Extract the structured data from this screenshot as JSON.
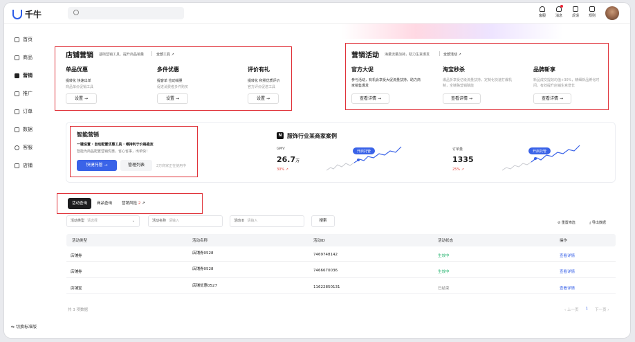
{
  "app": {
    "name": "千牛"
  },
  "top_actions": [
    {
      "label": "客服",
      "icon": "headset-icon"
    },
    {
      "label": "消息",
      "icon": "bell-icon"
    },
    {
      "label": "反馈",
      "icon": "edit-icon"
    },
    {
      "label": "规则",
      "icon": "book-icon"
    }
  ],
  "sidebar": {
    "items": [
      {
        "label": "首页",
        "icon": "home-icon"
      },
      {
        "label": "商品",
        "icon": "box-icon"
      },
      {
        "label": "营销",
        "icon": "marketing-icon",
        "active": true
      },
      {
        "label": "推广",
        "icon": "send-icon"
      },
      {
        "label": "订单",
        "icon": "order-icon"
      },
      {
        "label": "数据",
        "icon": "chart-icon"
      },
      {
        "label": "客服",
        "icon": "service-icon"
      },
      {
        "label": "店铺",
        "icon": "shop-icon"
      }
    ],
    "switch_label": "切换标准版"
  },
  "store_marketing": {
    "title": "店铺营销",
    "subtitle": "基础营销工具、提升商品销量",
    "link": "全部工具",
    "cards": [
      {
        "title": "单品优惠",
        "tags": "提转化  快速出单",
        "desc": "商品单价促销工具",
        "button": "设置"
      },
      {
        "title": "多件优惠",
        "tags": "提客单  拉动销量",
        "desc": "促进消费者多件购买",
        "button": "设置"
      },
      {
        "title": "评价有礼",
        "tags": "提转化  积累优质评价",
        "desc": "官方评价促进工具",
        "button": "设置"
      }
    ]
  },
  "campaigns": {
    "title": "营销活动",
    "subtitle": "海量流量加持，助力生意爆发",
    "link": "全部活动",
    "cards": [
      {
        "title": "官方大促",
        "desc": "参与活动，有机会享受大促流量扶持，助力商家销售爆发",
        "button": "查看详情"
      },
      {
        "title": "淘宝秒杀",
        "desc": "爆品折享受亿级流量扶持，定制化快速打爆机制，全链路营销赋能",
        "button": "查看详情"
      },
      {
        "title": "品牌新享",
        "desc": "新品成交提效均值+30%，精细新品孵化时间，有效提升店铺生意增长",
        "button": "查看详情"
      }
    ]
  },
  "smart_marketing": {
    "title": "智能营销",
    "line": "一键设置 · 自动配置优惠工具 · 维持利于价格稳定",
    "desc": "智能为商品配置营销优惠，省心省事，出单快！",
    "primary_button": "快捷托管",
    "secondary_button": "管理列表",
    "note": "2万商家正在使用中"
  },
  "case": {
    "icon_text": "N",
    "title": "服饰行业某商家案例",
    "metrics": [
      {
        "label": "GMV",
        "value": "26.7",
        "unit": "万",
        "change": "30% ↗",
        "tag": "开启托管"
      },
      {
        "label": "订单量",
        "value": "1335",
        "unit": "",
        "change": "25% ↗",
        "tag": "开启托管"
      }
    ]
  },
  "tabs": [
    {
      "label": "活动查询",
      "active": true
    },
    {
      "label": "商品查询"
    },
    {
      "label": "营销风险",
      "badge": "2"
    }
  ],
  "filters": {
    "type_label": "活动类型",
    "type_placeholder": "请选择",
    "name_label": "活动名称",
    "name_placeholder": "请输入",
    "id_label": "活动ID",
    "id_placeholder": "请输入",
    "search_button": "搜索",
    "reset": "重置筛选",
    "export": "导出数据"
  },
  "table": {
    "headers": [
      "活动类型",
      "活动名称",
      "活动ID",
      "活动状态",
      "操作"
    ],
    "rows": [
      [
        "店铺券",
        "店铺券0528",
        "7469748142",
        "生效中",
        "查看详情"
      ],
      [
        "店铺券",
        "店铺券0528",
        "7466670036",
        "生效中",
        "查看详情"
      ],
      [
        "店铺宝",
        "店铺优惠0527",
        "11622850131",
        "已结束",
        "查看详情"
      ]
    ],
    "total": "共 3 项数据",
    "pager": {
      "prev": "上一页",
      "page": "1",
      "next": "下一页"
    }
  },
  "colors": {
    "accent": "#3a63e8",
    "highlight_border": "#e0333a",
    "success": "#2bb673",
    "danger": "#e2433a"
  }
}
